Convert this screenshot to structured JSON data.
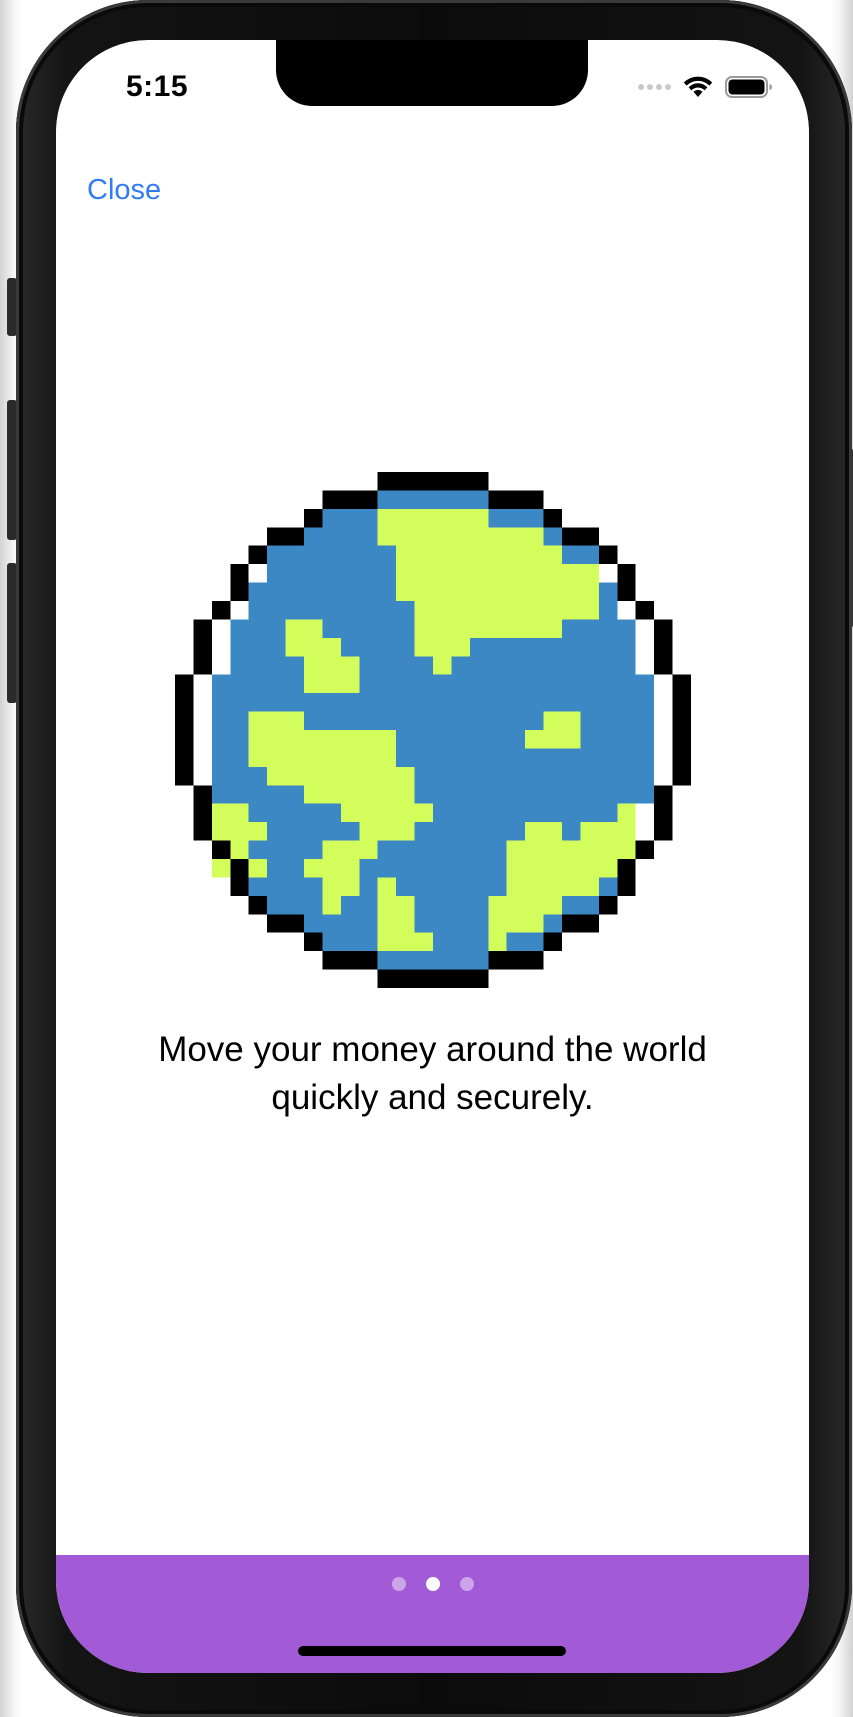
{
  "status_bar": {
    "time": "5:15",
    "icons": [
      "cellular-signal-icon",
      "wifi-icon",
      "battery-icon"
    ]
  },
  "nav": {
    "close_label": "Close"
  },
  "onboarding": {
    "illustration": "pixel-globe-icon",
    "caption_line1": "Move your money around the world",
    "caption_line2": "quickly and securely."
  },
  "pager": {
    "page_count": 3,
    "current_page": 2
  },
  "colors": {
    "accent": "#2f7cf6",
    "footer": "#a25ad7",
    "globe_ocean": "#3c88c5",
    "globe_land": "#d3fd5a",
    "globe_outline": "#000000"
  }
}
